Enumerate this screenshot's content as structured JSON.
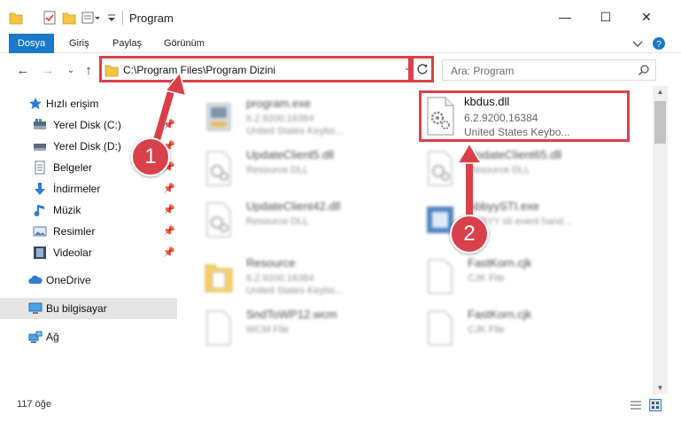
{
  "window": {
    "title": "Program",
    "minimize_glyph": "—",
    "maximize_glyph": "☐",
    "close_glyph": "✕"
  },
  "ribbon": {
    "tabs": [
      "Dosya",
      "Giriş",
      "Paylaş",
      "Görünüm"
    ],
    "accent_color": "#1979ca"
  },
  "address": {
    "path": "C:\\Program Files\\Program Dizini",
    "search_placeholder": "Ara: Program",
    "highlight_color": "#d9414a"
  },
  "nav": {
    "quick_access": "Hızlı erişim",
    "items": [
      {
        "label": "Yerel Disk (C:)",
        "icon": "drive-icon"
      },
      {
        "label": "Yerel Disk (D:)",
        "icon": "drive-icon"
      },
      {
        "label": "Belgeler",
        "icon": "documents-icon"
      },
      {
        "label": "İndirmeler",
        "icon": "download-icon"
      },
      {
        "label": "Müzik",
        "icon": "music-icon"
      },
      {
        "label": "Resimler",
        "icon": "pictures-icon"
      },
      {
        "label": "Videolar",
        "icon": "videos-icon"
      }
    ],
    "onedrive": "OneDrive",
    "this_pc": "Bu bilgisayar",
    "network": "Ağ"
  },
  "files": [
    {
      "name": "program.exe",
      "line2": "6.2.9200.16384",
      "line3": "United States Keybo...",
      "icon": "exe-icon"
    },
    {
      "name": "UpdateClient5.dll",
      "line2": "Resource DLL",
      "line3": "",
      "icon": "dll-icon"
    },
    {
      "name": "UpdateClient65.dll",
      "line2": "Resource DLL",
      "line3": "",
      "icon": "dll-icon"
    },
    {
      "name": "UpdateClient42.dll",
      "line2": "Resource DLL",
      "line3": "",
      "icon": "dll-icon"
    },
    {
      "name": "AbbyySTI.exe",
      "line2": "ABBYY sti event hand...",
      "line3": "",
      "icon": "exe-icon"
    },
    {
      "name": "Resource",
      "line2": "6.2.9200.16384",
      "line3": "United States Keybo...",
      "icon": "folder-icon"
    },
    {
      "name": "FastKorn.cjk",
      "line2": "CJK File",
      "line3": "",
      "icon": "file-icon"
    },
    {
      "name": "SndToWP12.wcm",
      "line2": "WCM File",
      "line3": "",
      "icon": "file-icon"
    },
    {
      "name": "FastKorn.cjk",
      "line2": "CJK File",
      "line3": "",
      "icon": "file-icon"
    }
  ],
  "highlighted_file": {
    "name": "kbdus.dll",
    "version": "6.2.9200.16384",
    "description": "United States Keybo..."
  },
  "callouts": [
    "1",
    "2"
  ],
  "status": {
    "item_count": "117 öğe"
  }
}
